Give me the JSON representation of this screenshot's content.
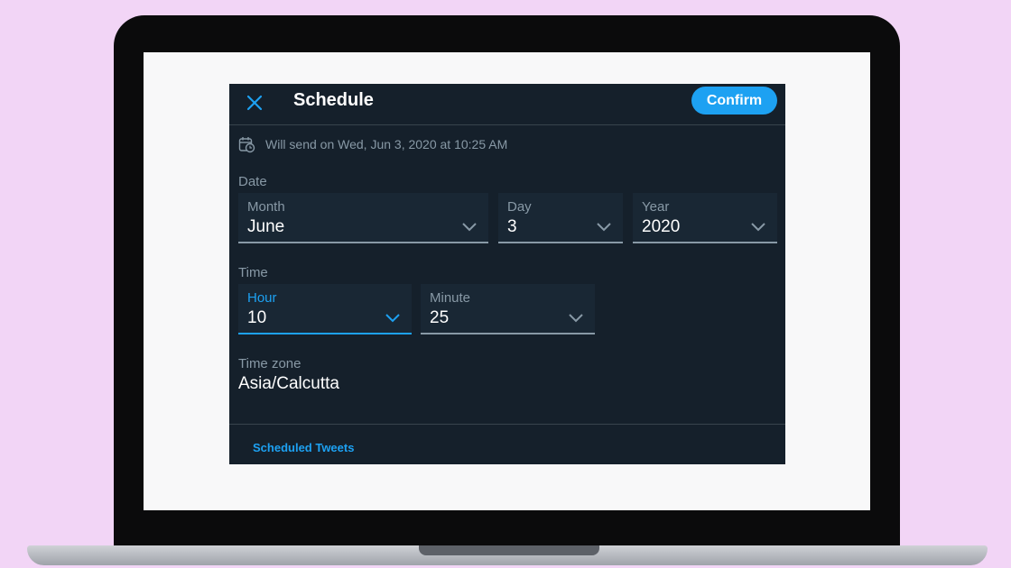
{
  "header": {
    "title": "Schedule",
    "confirm_label": "Confirm",
    "close_icon": "close-icon"
  },
  "send_info": {
    "icon": "calendar-clock-icon",
    "text": "Will send on Wed, Jun 3, 2020 at 10:25 AM"
  },
  "date": {
    "section_label": "Date",
    "month": {
      "label": "Month",
      "value": "June"
    },
    "day": {
      "label": "Day",
      "value": "3"
    },
    "year": {
      "label": "Year",
      "value": "2020"
    }
  },
  "time": {
    "section_label": "Time",
    "hour": {
      "label": "Hour",
      "value": "10",
      "focused": true
    },
    "minute": {
      "label": "Minute",
      "value": "25"
    }
  },
  "timezone": {
    "label": "Time zone",
    "value": "Asia/Calcutta"
  },
  "footer": {
    "scheduled_link": "Scheduled Tweets"
  },
  "colors": {
    "accent": "#1da1f2",
    "background": "#15202b",
    "field_background": "#192734",
    "muted_text": "#8899a6",
    "page_background": "#f2d5f6"
  }
}
